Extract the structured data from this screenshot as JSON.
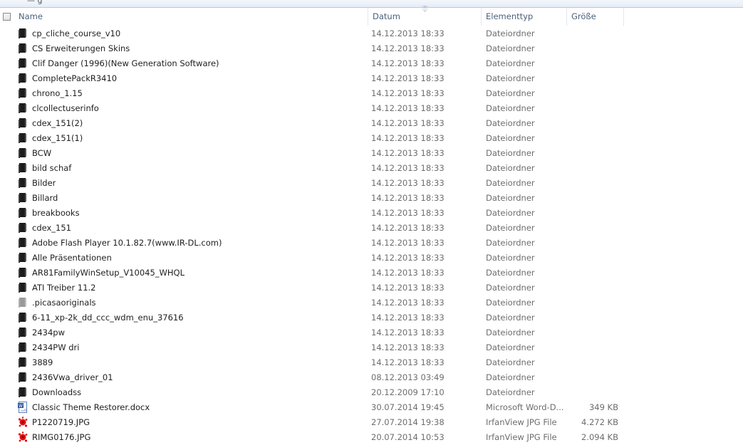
{
  "window": {
    "top_fragment": "— g"
  },
  "columns": {
    "name": "Name",
    "date": "Datum",
    "type": "Elementtyp",
    "size": "Größe"
  },
  "files": [
    {
      "name": "cp_cliche_course_v10",
      "date": "14.12.2013 18:33",
      "type": "Dateiordner",
      "size": "",
      "icon": "folder-icon"
    },
    {
      "name": "CS Erweiterungen Skins",
      "date": "14.12.2013 18:33",
      "type": "Dateiordner",
      "size": "",
      "icon": "folder-icon"
    },
    {
      "name": "Clif Danger (1996)(New Generation Software)",
      "date": "14.12.2013 18:33",
      "type": "Dateiordner",
      "size": "",
      "icon": "folder-icon"
    },
    {
      "name": "CompletePackR3410",
      "date": "14.12.2013 18:33",
      "type": "Dateiordner",
      "size": "",
      "icon": "folder-icon"
    },
    {
      "name": "chrono_1.15",
      "date": "14.12.2013 18:33",
      "type": "Dateiordner",
      "size": "",
      "icon": "folder-icon"
    },
    {
      "name": "clcollectuserinfo",
      "date": "14.12.2013 18:33",
      "type": "Dateiordner",
      "size": "",
      "icon": "folder-icon"
    },
    {
      "name": "cdex_151(2)",
      "date": "14.12.2013 18:33",
      "type": "Dateiordner",
      "size": "",
      "icon": "folder-icon"
    },
    {
      "name": "cdex_151(1)",
      "date": "14.12.2013 18:33",
      "type": "Dateiordner",
      "size": "",
      "icon": "folder-icon"
    },
    {
      "name": "BCW",
      "date": "14.12.2013 18:33",
      "type": "Dateiordner",
      "size": "",
      "icon": "folder-icon"
    },
    {
      "name": "bild schaf",
      "date": "14.12.2013 18:33",
      "type": "Dateiordner",
      "size": "",
      "icon": "folder-icon"
    },
    {
      "name": "Bilder",
      "date": "14.12.2013 18:33",
      "type": "Dateiordner",
      "size": "",
      "icon": "folder-icon"
    },
    {
      "name": "Billard",
      "date": "14.12.2013 18:33",
      "type": "Dateiordner",
      "size": "",
      "icon": "folder-icon"
    },
    {
      "name": "breakbooks",
      "date": "14.12.2013 18:33",
      "type": "Dateiordner",
      "size": "",
      "icon": "folder-icon"
    },
    {
      "name": "cdex_151",
      "date": "14.12.2013 18:33",
      "type": "Dateiordner",
      "size": "",
      "icon": "folder-icon"
    },
    {
      "name": "Adobe Flash Player 10.1.82.7(www.IR-DL.com)",
      "date": "14.12.2013 18:33",
      "type": "Dateiordner",
      "size": "",
      "icon": "folder-icon"
    },
    {
      "name": "Alle Präsentationen",
      "date": "14.12.2013 18:33",
      "type": "Dateiordner",
      "size": "",
      "icon": "folder-icon"
    },
    {
      "name": "AR81FamilyWinSetup_V10045_WHQL",
      "date": "14.12.2013 18:33",
      "type": "Dateiordner",
      "size": "",
      "icon": "folder-icon"
    },
    {
      "name": "ATI Treiber 11.2",
      "date": "14.12.2013 18:33",
      "type": "Dateiordner",
      "size": "",
      "icon": "folder-icon"
    },
    {
      "name": ".picasaoriginals",
      "date": "14.12.2013 18:33",
      "type": "Dateiordner",
      "size": "",
      "icon": "hidden-folder-icon"
    },
    {
      "name": "6-11_xp-2k_dd_ccc_wdm_enu_37616",
      "date": "14.12.2013 18:33",
      "type": "Dateiordner",
      "size": "",
      "icon": "folder-icon"
    },
    {
      "name": "2434pw",
      "date": "14.12.2013 18:33",
      "type": "Dateiordner",
      "size": "",
      "icon": "folder-icon"
    },
    {
      "name": "2434PW dri",
      "date": "14.12.2013 18:33",
      "type": "Dateiordner",
      "size": "",
      "icon": "folder-icon"
    },
    {
      "name": "3889",
      "date": "14.12.2013 18:33",
      "type": "Dateiordner",
      "size": "",
      "icon": "folder-icon"
    },
    {
      "name": "2436Vwa_driver_01",
      "date": "08.12.2013 03:49",
      "type": "Dateiordner",
      "size": "",
      "icon": "folder-icon"
    },
    {
      "name": "Downloadss",
      "date": "20.12.2009 17:10",
      "type": "Dateiordner",
      "size": "",
      "icon": "folder-icon"
    },
    {
      "name": "Classic Theme Restorer.docx",
      "date": "30.07.2014 19:45",
      "type": "Microsoft Word-D...",
      "size": "349 KB",
      "icon": "word-document-icon"
    },
    {
      "name": "P1220719.JPG",
      "date": "27.07.2014 19:38",
      "type": "IrfanView JPG File",
      "size": "4.272 KB",
      "icon": "irfanview-image-icon"
    },
    {
      "name": "RIMG0176.JPG",
      "date": "20.07.2014 10:53",
      "type": "IrfanView JPG File",
      "size": "2.094 KB",
      "icon": "irfanview-image-icon"
    }
  ],
  "colors": {
    "folder": "#1c1c1c",
    "hidden_folder": "#9a9a9a",
    "header_text": "#4c607a",
    "secondary_text": "#6d6d6d",
    "irfanview_red": "#e01010",
    "word_blue": "#2b5797"
  }
}
